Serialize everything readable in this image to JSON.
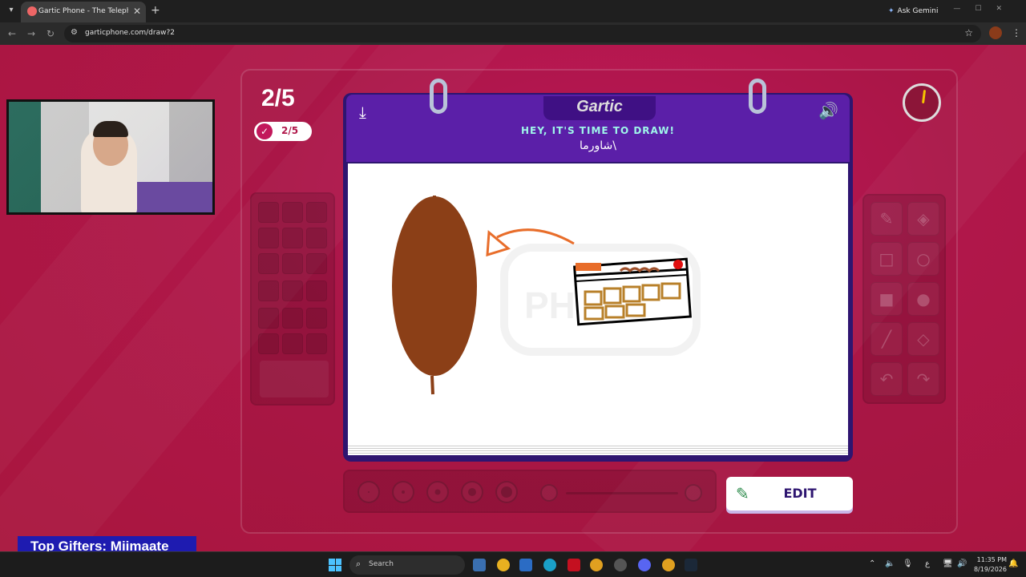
{
  "browser": {
    "tab_title": "Gartic Phone - The Telephone Game",
    "new_tab": "+",
    "close": "✕",
    "ask_gemini": "Ask Gemini",
    "url": "garticphone.com/draw?2"
  },
  "game": {
    "round": "2/5",
    "players_done": "2/5",
    "logo": "Gartic",
    "instruction": "HEY, IT'S TIME TO DRAW!",
    "prompt_word": "شاورما\\",
    "edit_label": "EDIT",
    "timer_progress": 0.02
  },
  "overlay": {
    "top_gifters": "Top Gifters: Miimaate"
  },
  "taskbar": {
    "search_placeholder": "Search",
    "time": "11:35 PM",
    "date": "8/19/2026",
    "lang": "ع"
  },
  "colors": {
    "background": "#b0174a",
    "notebook_header": "#5b1fa8",
    "instruction_text": "#9ff5ea",
    "drawing_brown": "#8b3f17",
    "drawing_orange": "#e86d2a"
  },
  "icons": {
    "download": "download-icon",
    "sound": "speaker-icon",
    "edit": "pencil-icon",
    "check": "check-icon"
  }
}
